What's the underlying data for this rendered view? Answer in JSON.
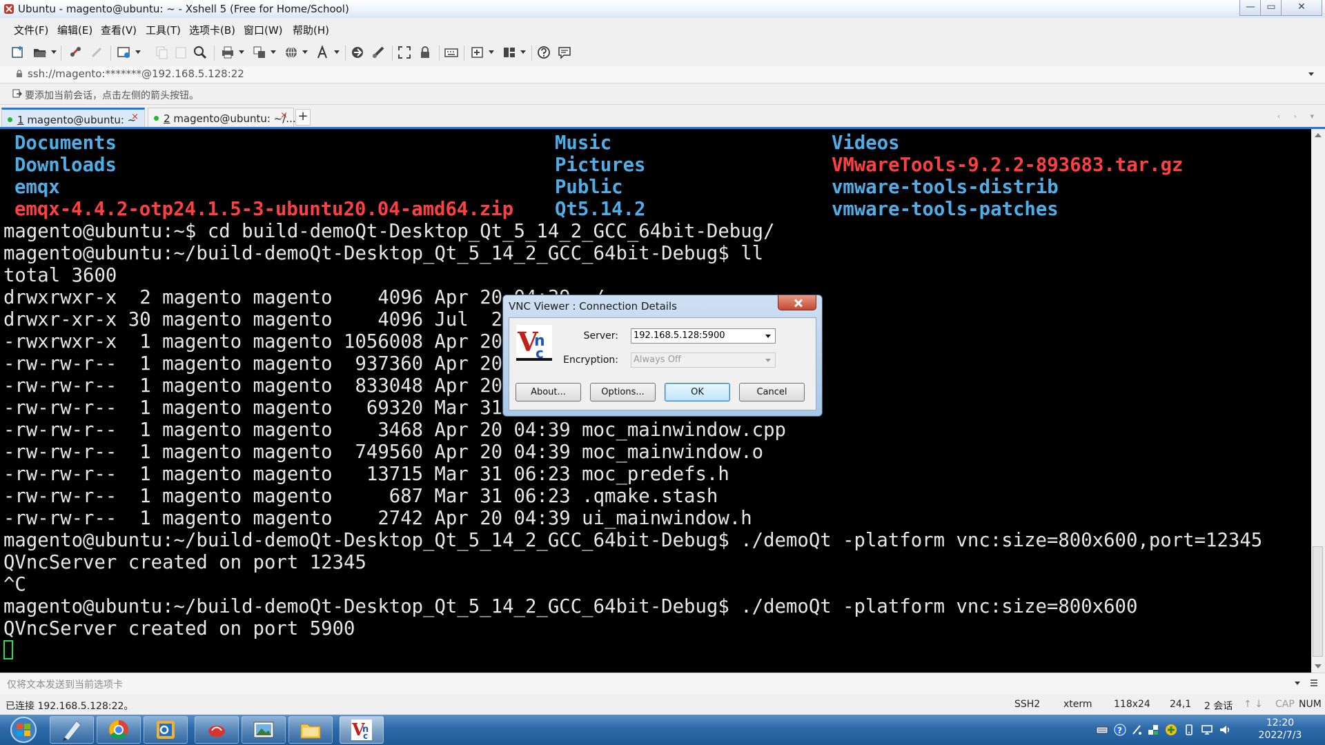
{
  "window": {
    "title": "Ubuntu - magento@ubuntu: ~ - Xshell 5 (Free for Home/School)",
    "min_glyph": "—",
    "max_glyph": "▭",
    "close_glyph": "✕"
  },
  "menu": [
    "文件(F)",
    "编辑(E)",
    "查看(V)",
    "工具(T)",
    "选项卡(B)",
    "窗口(W)",
    "帮助(H)"
  ],
  "address": {
    "value": "ssh://magento:*******@192.168.5.128:22"
  },
  "hint": {
    "text": "要添加当前会话，点击左侧的箭头按钮。"
  },
  "tabs": [
    {
      "num": "1",
      "label": " magento@ubuntu: ~",
      "close": "×"
    },
    {
      "num": "2",
      "label": " magento@ubuntu: ~/...",
      "close": "×"
    }
  ],
  "tab_add": "+",
  "tab_nav": "‹ › ▾",
  "terminal": {
    "ls_columns": [
      [
        {
          "name": "Documents",
          "kind": "dir"
        },
        {
          "name": "Downloads",
          "kind": "dir"
        },
        {
          "name": "emqx",
          "kind": "dir"
        },
        {
          "name": "emqx-4.4.2-otp24.1.5-3-ubuntu20.04-amd64.zip",
          "kind": "arch"
        }
      ],
      [
        {
          "name": "Music",
          "kind": "dir"
        },
        {
          "name": "Pictures",
          "kind": "dir"
        },
        {
          "name": "Public",
          "kind": "dir"
        },
        {
          "name": "Qt5.14.2",
          "kind": "dir"
        }
      ],
      [
        {
          "name": "Videos",
          "kind": "dir"
        },
        {
          "name": "VMwareTools-9.2.2-893683.tar.gz",
          "kind": "arch"
        },
        {
          "name": "vmware-tools-distrib",
          "kind": "dir"
        },
        {
          "name": "vmware-tools-patches",
          "kind": "dir"
        }
      ]
    ],
    "lines": [
      "magento@ubuntu:~$ cd build-demoQt-Desktop_Qt_5_14_2_GCC_64bit-Debug/",
      "magento@ubuntu:~/build-demoQt-Desktop_Qt_5_14_2_GCC_64bit-Debug$ ll",
      "total 3600",
      "drwxrwxr-x  2 magento magento    4096 Apr 20 04:39 ./",
      "drwxr-xr-x 30 magento magento    4096 Jul  2",
      "-rwxrwxr-x  1 magento magento 1056008 Apr 20",
      "-rw-rw-r--  1 magento magento  937360 Apr 20",
      "-rw-rw-r--  1 magento magento  833048 Apr 20",
      "-rw-rw-r--  1 magento magento   69320 Mar 31",
      "-rw-rw-r--  1 magento magento    3468 Apr 20 04:39 moc_mainwindow.cpp",
      "-rw-rw-r--  1 magento magento  749560 Apr 20 04:39 moc_mainwindow.o",
      "-rw-rw-r--  1 magento magento   13715 Mar 31 06:23 moc_predefs.h",
      "-rw-rw-r--  1 magento magento     687 Mar 31 06:23 .qmake.stash",
      "-rw-rw-r--  1 magento magento    2742 Apr 20 04:39 ui_mainwindow.h",
      "magento@ubuntu:~/build-demoQt-Desktop_Qt_5_14_2_GCC_64bit-Debug$ ./demoQt -platform vnc:size=800x600,port=12345",
      "QVncServer created on port 12345",
      "^C",
      "magento@ubuntu:~/build-demoQt-Desktop_Qt_5_14_2_GCC_64bit-Debug$ ./demoQt -platform vnc:size=800x600",
      "QVncServer created on port 5900"
    ]
  },
  "compose": {
    "placeholder": "仅将文本发送到当前选项卡"
  },
  "status": {
    "connected": "已连接 192.168.5.128:22。",
    "protocol": "SSH2",
    "term": "xterm",
    "size": "118x24",
    "cursor_pos": "24,1",
    "sessions": "2 会话",
    "arrows": "↑ ↓",
    "cap": "CAP",
    "num": "NUM"
  },
  "taskbar": {
    "time": "12:20",
    "date": "2022/7/3"
  },
  "vnc_dialog": {
    "title": "VNC Viewer : Connection Details",
    "server_label": "Server:",
    "server_value": "192.168.5.128:5900",
    "encryption_label": "Encryption:",
    "encryption_value": "Always Off",
    "about": "About...",
    "options": "Options...",
    "ok": "OK",
    "cancel": "Cancel"
  },
  "colors": {
    "accent": "#1e78d7",
    "terminal_bg": "#000000",
    "terminal_fg": "#e8e8e8",
    "dir": "#4faee8",
    "archive": "#ff4040",
    "cursor": "#22e05a"
  }
}
